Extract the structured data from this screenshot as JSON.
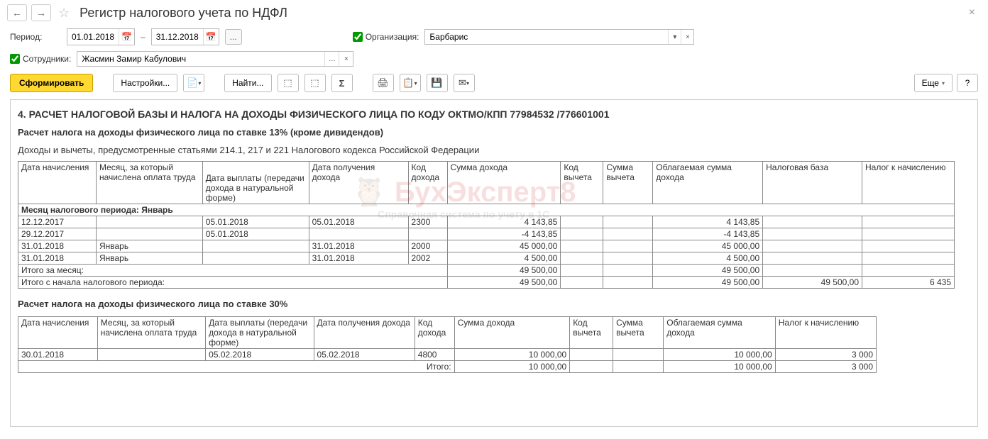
{
  "header": {
    "title": "Регистр налогового учета по НДФЛ"
  },
  "filters": {
    "period_label": "Период:",
    "date_from": "01.01.2018",
    "date_to": "31.12.2018",
    "dots": "...",
    "org_label": "Организация:",
    "org_value": "Барбарис",
    "emp_label": "Сотрудники:",
    "emp_value": "Жасмин Замир Кабулович"
  },
  "toolbar": {
    "form": "Сформировать",
    "settings": "Настройки...",
    "find": "Найти...",
    "more": "Еще",
    "help": "?"
  },
  "report": {
    "section4": "4. РАСЧЕТ НАЛОГОВОЙ БАЗЫ И НАЛОГА НА ДОХОДЫ ФИЗИЧЕСКОГО ЛИЦА ПО КОДУ ОКТМО/КПП 77984532   /776601001",
    "sub13": "Расчет налога на доходы физического лица по ставке 13% (кроме дивидендов)",
    "desc13": "Доходы и вычеты, предусмотренные статьями 214.1, 217 и 221 Налогового кодекса Российской Федерации",
    "cols": {
      "c1": "Дата начисления",
      "c2": "Месяц, за который начислена оплата труда",
      "c3": "Дата выплаты (передачи дохода в натуральной форме)",
      "c4": "Дата получения дохода",
      "c5": "Код дохода",
      "c6": "Сумма дохода",
      "c7": "Код вычета",
      "c8": "Сумма вычета",
      "c9": "Облагаемая сумма дохода",
      "c10": "Налоговая база",
      "c11": "Налог к начислению"
    },
    "period_jan": "Месяц налогового периода: Январь",
    "rows13": [
      {
        "d_nach": "12.12.2017",
        "mes": "",
        "d_vyp": "05.01.2018",
        "d_pol": "05.01.2018",
        "kod": "2300",
        "sum": "4 143,85",
        "kv": "",
        "sv": "",
        "obl": "4 143,85",
        "nb": "",
        "nal": ""
      },
      {
        "d_nach": "29.12.2017",
        "mes": "",
        "d_vyp": "05.01.2018",
        "d_pol": "",
        "kod": "",
        "sum": "-4 143,85",
        "kv": "",
        "sv": "",
        "obl": "-4 143,85",
        "nb": "",
        "nal": ""
      },
      {
        "d_nach": "31.01.2018",
        "mes": "Январь",
        "d_vyp": "",
        "d_pol": "31.01.2018",
        "kod": "2000",
        "sum": "45 000,00",
        "kv": "",
        "sv": "",
        "obl": "45 000,00",
        "nb": "",
        "nal": ""
      },
      {
        "d_nach": "31.01.2018",
        "mes": "Январь",
        "d_vyp": "",
        "d_pol": "31.01.2018",
        "kod": "2002",
        "sum": "4 500,00",
        "kv": "",
        "sv": "",
        "obl": "4 500,00",
        "nb": "",
        "nal": ""
      }
    ],
    "itogo_mes_label": "Итого за месяц:",
    "itogo_mes_sum": "49 500,00",
    "itogo_mes_obl": "49 500,00",
    "itogo_per_label": "Итого с начала налогового периода:",
    "itogo_per_sum": "49 500,00",
    "itogo_per_obl": "49 500,00",
    "itogo_per_nb": "49 500,00",
    "itogo_per_nal": "6 435",
    "sub30": "Расчет налога на доходы физического лица по ставке 30%",
    "cols30": {
      "c1": "Дата начисления",
      "c2": "Месяц, за который начислена оплата труда",
      "c3": "Дата выплаты (передачи дохода в натуральной форме)",
      "c4": "Дата получения дохода",
      "c5": "Код дохода",
      "c6": "Сумма дохода",
      "c7": "Код вычета",
      "c8": "Сумма вычета",
      "c9": "Облагаемая сумма дохода",
      "c10": "Налог к начислению"
    },
    "row30": {
      "d_nach": "30.01.2018",
      "mes": "",
      "d_vyp": "05.02.2018",
      "d_pol": "05.02.2018",
      "kod": "4800",
      "sum": "10 000,00",
      "kv": "",
      "sv": "",
      "obl": "10 000,00",
      "nal": "3 000"
    },
    "itogo30_label": "Итого:",
    "itogo30_sum": "10 000,00",
    "itogo30_obl": "10 000,00",
    "itogo30_nal": "3 000"
  },
  "watermark": {
    "big": "БухЭксперт8",
    "small": "Справочная система по учету в 1С"
  }
}
